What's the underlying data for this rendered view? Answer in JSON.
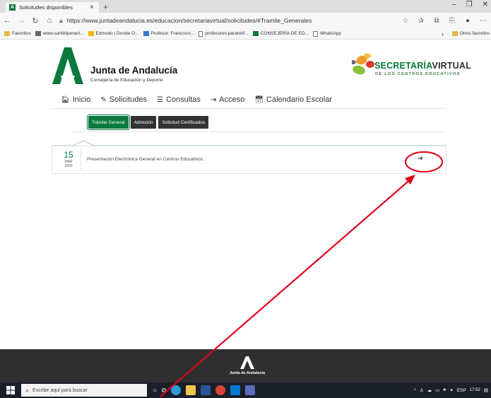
{
  "browser": {
    "tab_title": "Solicitudes disponibles",
    "tab_close": "×",
    "new_tab": "+",
    "url": "https://www.juntadeandalucia.es/educacion/secretariavirtual/solicitudes/#Tramite_Generales",
    "bookmarks": [
      "Favoritos",
      "www.sanfelipeneri...",
      "Edmodo | Donde O...",
      "Profesor: Francisco...",
      "profesores.paraninf...",
      "CONSEJERÍA DE ED...",
      "WhatsApp"
    ],
    "other_favorites": "Otros favoritos"
  },
  "header": {
    "org_name": "Junta de Andalucía",
    "org_sub": "Consejería de Educación y Deporte",
    "sv_title_a": "SECRETARÍA",
    "sv_title_b": "VIRTUAL",
    "sv_sub": "DE LOS CENTROS EDUCATIVOS"
  },
  "menu": {
    "items": [
      "Inicio",
      "Solicitudes",
      "Consultas",
      "Acceso",
      "Calendario Escolar"
    ]
  },
  "subtabs": [
    "Trámite General",
    "Admisión",
    "Solicitud Certificados"
  ],
  "listing": {
    "day": "15",
    "month": "MAR",
    "year": "2020",
    "text": "Presentación Electrónica General en Centros Educativos."
  },
  "footer": {
    "text": "Junta de Andalucía"
  },
  "taskbar": {
    "search_placeholder": "Escribe aquí para buscar",
    "lang": "ESP",
    "time": "17:52"
  },
  "colors": {
    "brand_green": "#0a7a3e",
    "annotation_red": "#e0001a"
  }
}
